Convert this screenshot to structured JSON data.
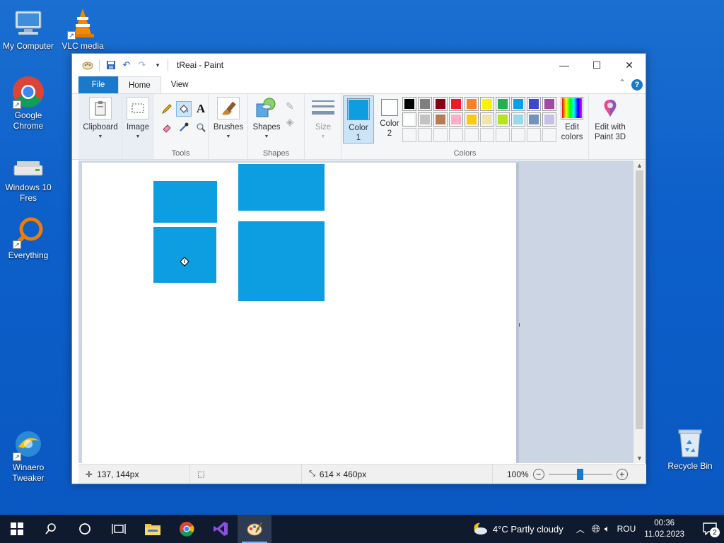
{
  "desktop": {
    "icons": [
      {
        "label": "My Computer"
      },
      {
        "label": "VLC media"
      },
      {
        "label": "Google Chrome"
      },
      {
        "label": "Windows 10 Fres"
      },
      {
        "label": "Everything"
      },
      {
        "label": "Winaero Tweaker"
      }
    ],
    "recycle_bin": "Recycle Bin"
  },
  "window": {
    "title": "tReai - Paint",
    "tabs": {
      "file": "File",
      "home": "Home",
      "view": "View"
    },
    "help": "?"
  },
  "ribbon": {
    "clipboard": "Clipboard",
    "image": "Image",
    "tools_label": "Tools",
    "brushes": "Brushes",
    "shapes_btn": "Shapes",
    "shapes_label": "Shapes",
    "size": "Size",
    "color1": "Color 1",
    "color2": "Color 2",
    "colors_label": "Colors",
    "edit_colors": "Edit colors",
    "edit_paint3d": "Edit with Paint 3D",
    "palette_row1": [
      "#000000",
      "#7f7f7f",
      "#880015",
      "#ed1c24",
      "#ff7f27",
      "#fff200",
      "#22b14c",
      "#00a2e8",
      "#3f48cc",
      "#a349a4"
    ],
    "palette_row2": [
      "#ffffff",
      "#c3c3c3",
      "#b97a57",
      "#ffaec9",
      "#ffc90e",
      "#efe4b0",
      "#b5e61d",
      "#99d9ea",
      "#7092be",
      "#c8bfe7"
    ],
    "color1_value": "#0c9ee0",
    "color2_value": "#ffffff"
  },
  "status": {
    "cursor_pos": "137, 144px",
    "canvas_size": "614 × 460px",
    "zoom": "100%"
  },
  "taskbar": {
    "weather": "4°C  Partly cloudy",
    "lang": "ROU",
    "time": "00:36",
    "date": "11.02.2023",
    "notifications": "2"
  },
  "colors": {
    "accent": "#1979ca",
    "shape_fill": "#0c9ee0"
  }
}
